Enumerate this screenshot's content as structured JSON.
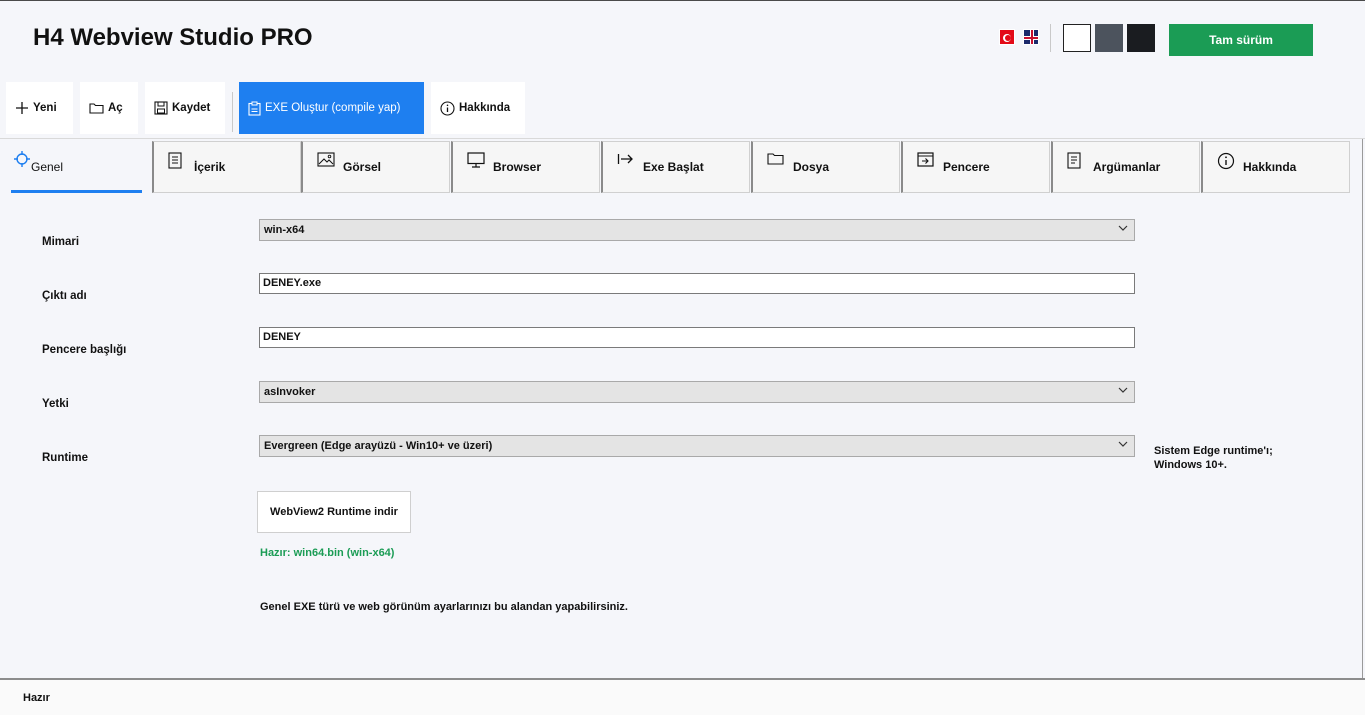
{
  "app": {
    "title": "H4 Webview Studio PRO"
  },
  "header": {
    "languages": [
      "tr-flag",
      "en-flag"
    ],
    "themes": [
      {
        "name": "light",
        "color": "#ffffff"
      },
      {
        "name": "gray",
        "color": "#4c535d"
      },
      {
        "name": "dark",
        "color": "#1a1c20"
      }
    ],
    "full_version_label": "Tam sürüm"
  },
  "toolbar": {
    "new_label": "Yeni",
    "open_label": "Aç",
    "save_label": "Kaydet",
    "build_label": "EXE Oluştur (compile yap)",
    "about_label": "Hakkında"
  },
  "tabs": [
    {
      "label": "Genel",
      "icon": "crosshair-icon",
      "active": true
    },
    {
      "label": "İçerik",
      "icon": "document-icon"
    },
    {
      "label": "Görsel",
      "icon": "image-icon"
    },
    {
      "label": "Browser",
      "icon": "monitor-icon"
    },
    {
      "label": "Exe Başlat",
      "icon": "launch-arrow-icon"
    },
    {
      "label": "Dosya",
      "icon": "folder-icon"
    },
    {
      "label": "Pencere",
      "icon": "window-icon"
    },
    {
      "label": "Argümanlar",
      "icon": "list-document-icon"
    },
    {
      "label": "Hakkında",
      "icon": "info-icon"
    }
  ],
  "form": {
    "arch": {
      "label": "Mimari",
      "value": "win-x64"
    },
    "output": {
      "label": "Çıktı adı",
      "value": "DENEY.exe"
    },
    "window_title": {
      "label": "Pencere başlığı",
      "value": "DENEY"
    },
    "privilege": {
      "label": "Yetki",
      "value": "asInvoker"
    },
    "runtime": {
      "label": "Runtime",
      "value": "Evergreen (Edge arayüzü - Win10+ ve üzeri)",
      "note_line1": "Sistem Edge runtime'ı;",
      "note_line2": "Windows 10+."
    },
    "download_label": "WebView2 Runtime indir",
    "ready_text": "Hazır: win64.bin (win-x64)",
    "hint": "Genel EXE türü ve web görünüm ayarlarınızı bu alandan yapabilirsiniz."
  },
  "colors": {
    "accent": "#1e7ff0",
    "success": "#1b9c55"
  },
  "status": {
    "text": "Hazır"
  }
}
